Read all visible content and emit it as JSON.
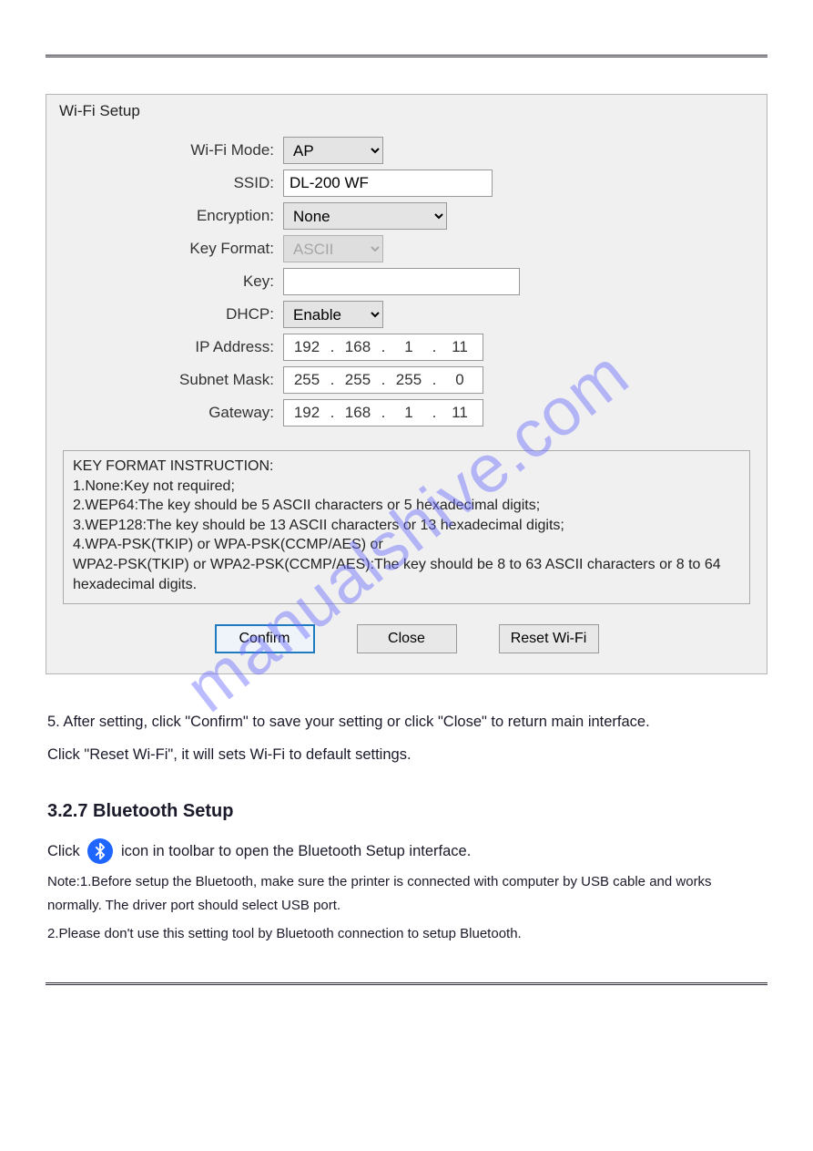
{
  "panel": {
    "title": "Wi-Fi Setup",
    "labels": {
      "wifi_mode": "Wi-Fi Mode:",
      "ssid": "SSID:",
      "encryption": "Encryption:",
      "key_format": "Key Format:",
      "key": "Key:",
      "dhcp": "DHCP:",
      "ip_address": "IP Address:",
      "subnet_mask": "Subnet Mask:",
      "gateway": "Gateway:"
    },
    "values": {
      "wifi_mode": "AP",
      "ssid": "DL-200 WF",
      "encryption": "None",
      "key_format": "ASCII",
      "key": "",
      "dhcp": "Enable",
      "ip": {
        "a": "192",
        "b": "168",
        "c": "1",
        "d": "11"
      },
      "mask": {
        "a": "255",
        "b": "255",
        "c": "255",
        "d": "0"
      },
      "gw": {
        "a": "192",
        "b": "168",
        "c": "1",
        "d": "11"
      }
    },
    "instruction": {
      "heading": "KEY FORMAT INSTRUCTION:",
      "line1": "1.None:Key not required;",
      "line2": "2.WEP64:The key should be 5 ASCII characters or 5 hexadecimal digits;",
      "line3": "3.WEP128:The key should be 13 ASCII characters or 13 hexadecimal digits;",
      "line4": "4.WPA-PSK(TKIP) or WPA-PSK(CCMP/AES) or",
      "line5": "WPA2-PSK(TKIP) or WPA2-PSK(CCMP/AES):The key should be 8 to 63 ASCII characters or 8 to 64 hexadecimal digits."
    },
    "buttons": {
      "confirm": "Confirm",
      "close": "Close",
      "reset": "Reset Wi-Fi"
    }
  },
  "doc": {
    "p1": "5. After setting, click \"Confirm\" to save your setting or click \"Close\" to return main interface.",
    "p2": "Click \"Reset Wi-Fi\", it will sets Wi-Fi to default settings.",
    "h1": "3.2.7 Bluetooth Setup",
    "p3_a": "Click ",
    "p3_b": " icon in toolbar to open the Bluetooth Setup interface.",
    "note1": "Note:1.Before setup the Bluetooth, make sure the printer is connected with computer by USB cable and works normally. The driver port should select USB port.",
    "note2": "2.Please don't use this setting tool by Bluetooth connection to setup Bluetooth.",
    "watermark": "manualshive.com"
  }
}
